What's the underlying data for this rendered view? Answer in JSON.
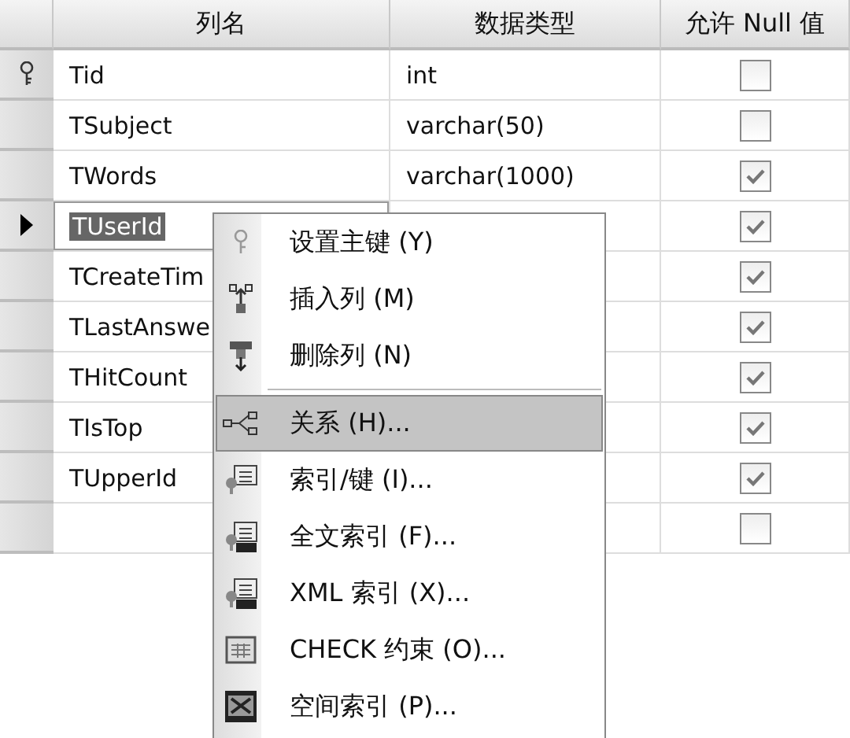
{
  "table": {
    "columns": [
      "列名",
      "数据类型",
      "允许 Null 值"
    ],
    "rows": [
      {
        "kind": "key",
        "name": "Tid",
        "data_type": "int",
        "allow_null": false,
        "selected": false
      },
      {
        "name": "TSubject",
        "data_type": "varchar(50)",
        "allow_null": false,
        "selected": false
      },
      {
        "name": "TWords",
        "data_type": "varchar(1000)",
        "allow_null": true,
        "selected": false
      },
      {
        "kind": "arrow",
        "name": "TUserId",
        "allow_null": true,
        "selected": true
      },
      {
        "name": "TCreateTim",
        "allow_null": true,
        "selected": false
      },
      {
        "name": "TLastAnswe",
        "allow_null": true,
        "selected": false
      },
      {
        "name": "THitCount",
        "allow_null": true,
        "selected": false
      },
      {
        "name": "TIsTop",
        "allow_null": true,
        "selected": false
      },
      {
        "name": "TUpperId",
        "allow_null": true,
        "selected": false
      },
      {
        "allow_null": false,
        "selected": false
      }
    ]
  },
  "context_menu": {
    "items": [
      {
        "kind": "key",
        "label": "设置主键 (Y)",
        "selected": false
      },
      {
        "kind": "insert",
        "label": "插入列 (M)",
        "selected": false
      },
      {
        "kind": "delete",
        "label": "删除列 (N)",
        "selected": false
      },
      {
        "kind": "separator"
      },
      {
        "kind": "relation",
        "label": "关系 (H)...",
        "selected": true
      },
      {
        "kind": "index",
        "label": "索引/键 (I)...",
        "selected": false
      },
      {
        "kind": "fulltext",
        "label": "全文索引 (F)...",
        "selected": false
      },
      {
        "kind": "xml",
        "label": "XML 索引 (X)...",
        "selected": false
      },
      {
        "kind": "check",
        "label": "CHECK 约束 (O)...",
        "selected": false
      },
      {
        "kind": "spatial",
        "label": "空间索引 (P)...",
        "selected": false
      }
    ]
  }
}
